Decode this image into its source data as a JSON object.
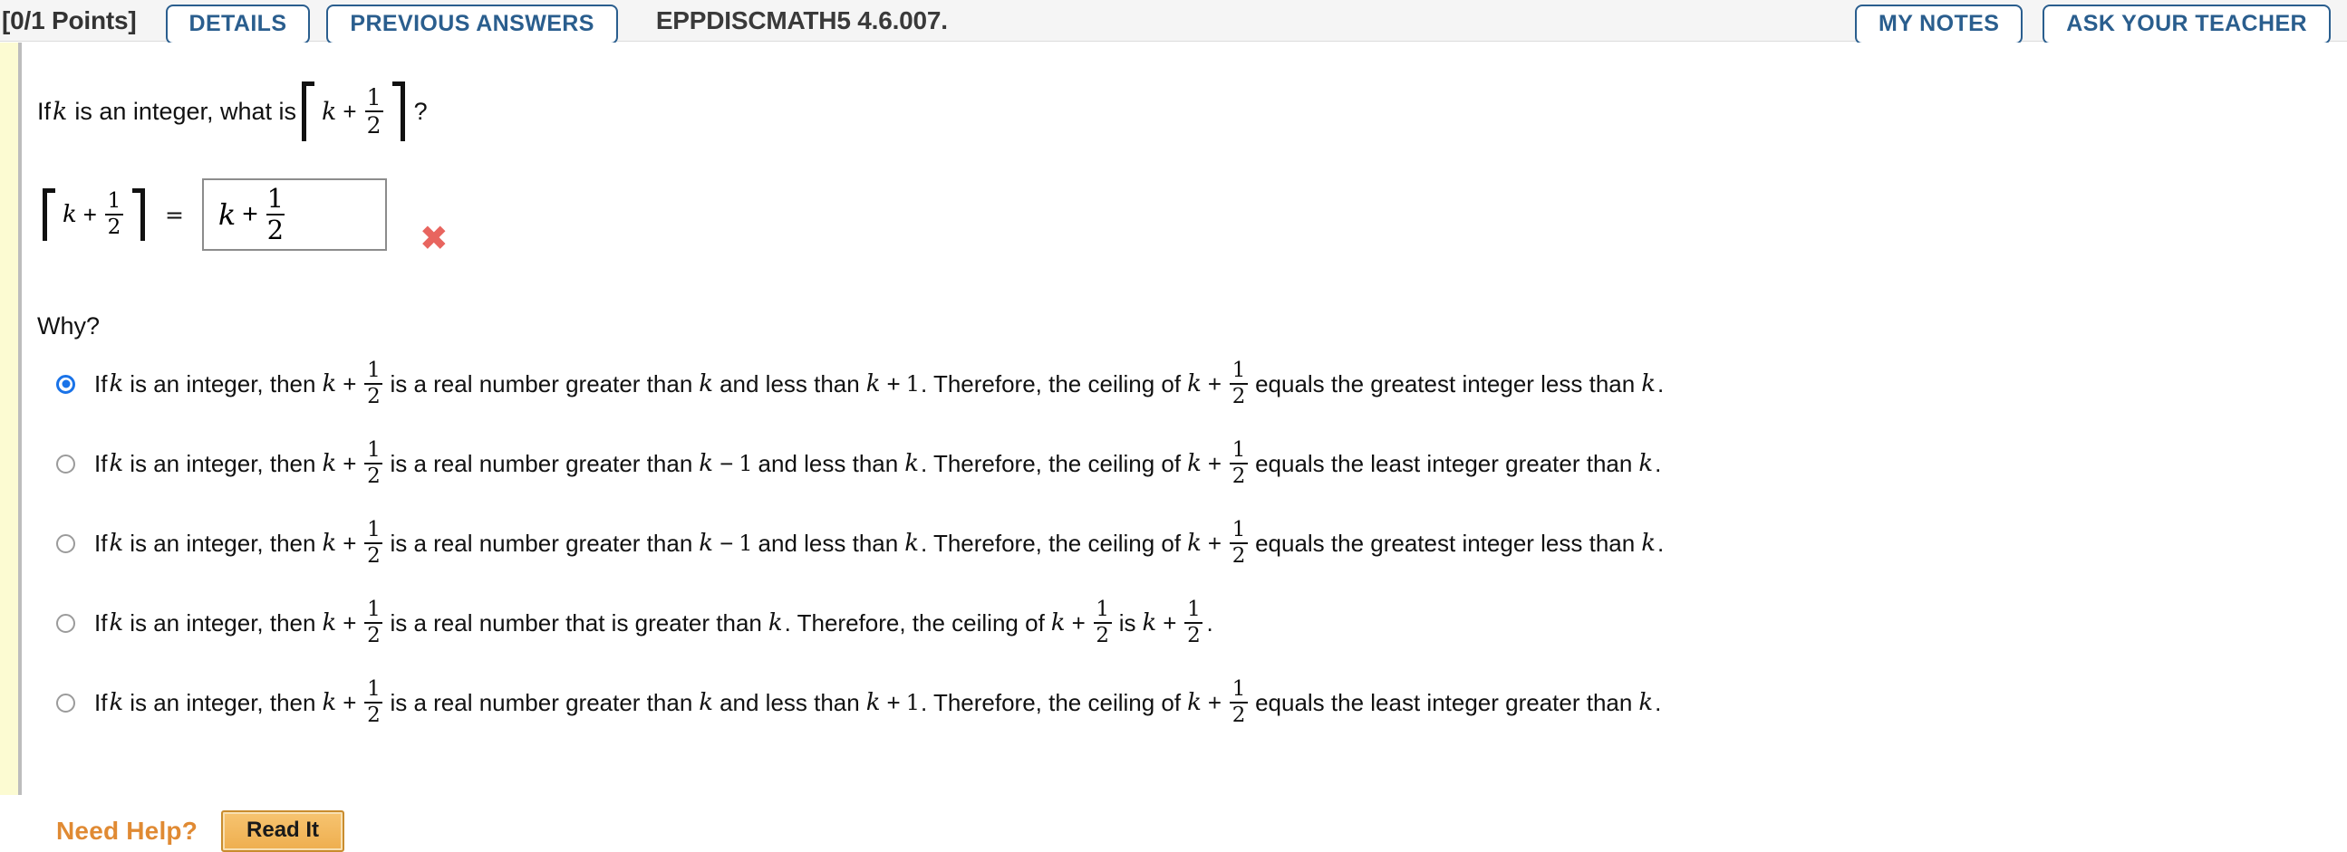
{
  "header": {
    "points": "[0/1 Points]",
    "details_label": "DETAILS",
    "previous_answers_label": "PREVIOUS ANSWERS",
    "question_id": "EPPDISCMATH5 4.6.007.",
    "my_notes_label": "MY NOTES",
    "ask_your_teacher_label": "ASK YOUR TEACHER",
    "accent_color": "#2a5e8e"
  },
  "question": {
    "prompt_prefix": "If",
    "prompt_var": "k",
    "prompt_mid": "is an integer, what is",
    "expr_var": "k",
    "expr_op": "+",
    "expr_num": "1",
    "expr_den": "2",
    "prompt_suffix": "?"
  },
  "answer": {
    "lhs_var": "k",
    "lhs_op": "+",
    "lhs_num": "1",
    "lhs_den": "2",
    "equals": "=",
    "input_value_var": "k",
    "input_value_op": "+",
    "input_value_num": "1",
    "input_value_den": "2",
    "grade_icon": "incorrect-x-icon",
    "grade_glyph": "✖",
    "grade_color": "#e8655f"
  },
  "why": {
    "label": "Why?",
    "selected_index": 0,
    "options": [
      {
        "p1": "If",
        "v1": "k",
        "p2": "is an integer, then",
        "v2": "k",
        "op2": "+",
        "num2": "1",
        "den2": "2",
        "p3": "is a real number greater than",
        "v3": "k",
        "p4": "and less than",
        "v4": "k",
        "op4": "+",
        "n4": "1",
        "p5": ". Therefore, the ceiling of",
        "v5": "k",
        "op5": "+",
        "num5": "1",
        "den5": "2",
        "p6": "equals the greatest integer less than",
        "v6": "k",
        "p7": ".",
        "selected": true
      },
      {
        "p1": "If",
        "v1": "k",
        "p2": "is an integer, then",
        "v2": "k",
        "op2": "+",
        "num2": "1",
        "den2": "2",
        "p3": "is a real number greater than",
        "v3": "k",
        "op3": "−",
        "n3": "1",
        "p4": "and less than",
        "v4": "k",
        "p5": ". Therefore, the ceiling of",
        "v5": "k",
        "op5": "+",
        "num5": "1",
        "den5": "2",
        "p6": "equals the least integer greater than",
        "v6": "k",
        "p7": ".",
        "selected": false
      },
      {
        "p1": "If",
        "v1": "k",
        "p2": "is an integer, then",
        "v2": "k",
        "op2": "+",
        "num2": "1",
        "den2": "2",
        "p3": "is a real number greater than",
        "v3": "k",
        "op3": "−",
        "n3": "1",
        "p4": "and less than",
        "v4": "k",
        "p5": ". Therefore, the ceiling of",
        "v5": "k",
        "op5": "+",
        "num5": "1",
        "den5": "2",
        "p6": "equals the greatest integer less than",
        "v6": "k",
        "p7": ".",
        "selected": false
      },
      {
        "p1": "If",
        "v1": "k",
        "p2": "is an integer, then",
        "v2": "k",
        "op2": "+",
        "num2": "1",
        "den2": "2",
        "p3": "is a real number that is greater than",
        "v3": "k",
        "p5": ". Therefore, the ceiling of",
        "v5": "k",
        "op5": "+",
        "num5": "1",
        "den5": "2",
        "p6": "is",
        "v6": "k",
        "op6": "+",
        "num6": "1",
        "den6": "2",
        "p7": ".",
        "selected": false
      },
      {
        "p1": "If",
        "v1": "k",
        "p2": "is an integer, then",
        "v2": "k",
        "op2": "+",
        "num2": "1",
        "den2": "2",
        "p3": "is a real number greater than",
        "v3": "k",
        "p4": "and less than",
        "v4": "k",
        "op4": "+",
        "n4": "1",
        "p5": ". Therefore, the ceiling of",
        "v5": "k",
        "op5": "+",
        "num5": "1",
        "den5": "2",
        "p6": "equals the least integer greater than",
        "v6": "k",
        "p7": ".",
        "selected": false
      }
    ]
  },
  "footer": {
    "need_help_label": "Need Help?",
    "read_it_label": "Read It",
    "need_help_color": "#e08a33"
  }
}
